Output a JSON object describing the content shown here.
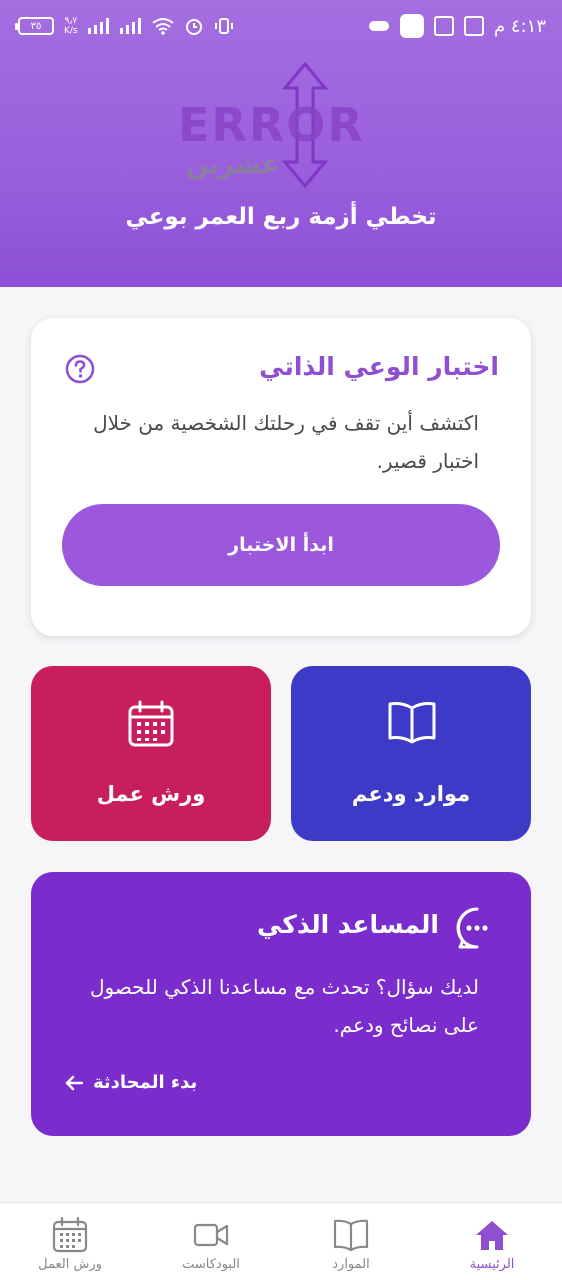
{
  "status_bar": {
    "time": "٤:١٣ م",
    "battery": "٣٥",
    "net_speed_value": "٩٫٧",
    "net_speed_unit": "K/s"
  },
  "header": {
    "logo_text": "ERROR",
    "logo_subtext": "عشرين",
    "title": "تخطي أزمة ربع العمر بوعي"
  },
  "quiz_card": {
    "title": "اختبار الوعي الذاتي",
    "description": "اكتشف أين تقف في رحلتك الشخصية من خلال اختبار قصير.",
    "button_label": "ابدأ الاختبار"
  },
  "tiles": {
    "resources_label": "موارد ودعم",
    "workshops_label": "ورش عمل"
  },
  "assistant_card": {
    "title": "المساعد الذكي",
    "description": "لديك سؤال؟ تحدث مع مساعدنا الذكي للحصول على نصائح ودعم.",
    "link_label": "بدء المحادثة"
  },
  "bottom_nav": {
    "items": [
      {
        "label": "الرئيسية",
        "icon": "home-icon",
        "active": true
      },
      {
        "label": "الموارد",
        "icon": "book-icon",
        "active": false
      },
      {
        "label": "البودكاست",
        "icon": "video-icon",
        "active": false
      },
      {
        "label": "ورش العمل",
        "icon": "calendar-icon",
        "active": false
      }
    ]
  },
  "colors": {
    "header_purple": "#9a5fdc",
    "accent_purple": "#8f4fd0",
    "resources_blue": "#3c3ac6",
    "workshops_red": "#c81e5c",
    "assistant_purple": "#7a2ccc"
  }
}
